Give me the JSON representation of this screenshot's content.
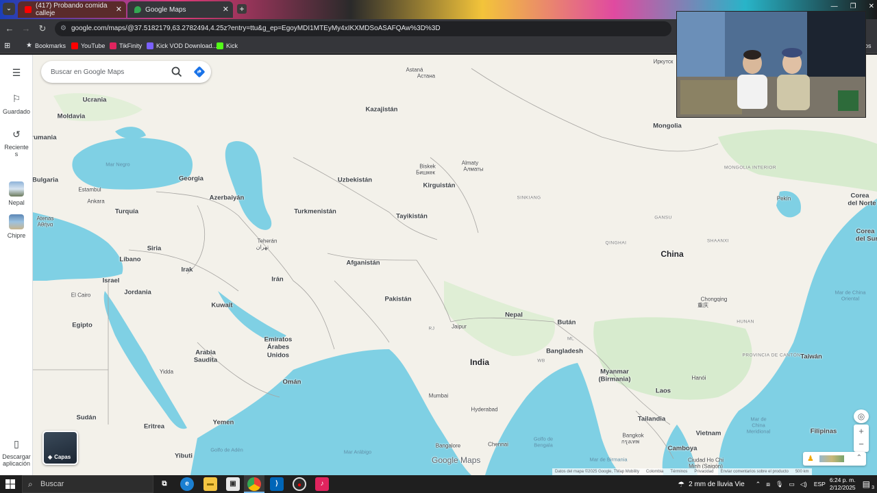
{
  "browser": {
    "tabs": [
      {
        "title": "(417) Probando comida calleje",
        "active": false
      },
      {
        "title": "Google Maps",
        "active": true
      }
    ],
    "url": "google.com/maps/@37.5182179,63.2782494,4.25z?entry=ttu&g_ep=EgoyMDI1MTEyMy4xIKXMDSoASAFQAw%3D%3D",
    "bookmarks": [
      "Bookmarks",
      "YouTube",
      "TikFinity",
      "Kick VOD Download...",
      "Kick"
    ],
    "bookmark_overflow": "os"
  },
  "maps": {
    "search_placeholder": "Buscar en Google Maps",
    "rail": {
      "saved": "Guardado",
      "recent_1": "Reciente",
      "recent_2": "s",
      "recent_places": [
        "Nepal",
        "Chipre"
      ],
      "download_1": "Descargar",
      "download_2": "aplicación"
    },
    "layers_label": "Capas",
    "logo": "Google Maps",
    "attribution": [
      "Datos del mapa ©2025 Google, TMap Mobility",
      "Colombia",
      "Términos",
      "Privacidad",
      "Enviar comentarios sobre el producto",
      "500 km"
    ],
    "labels": {
      "astana": "Astaná",
      "astana2": "Астана",
      "kazajistan": "Kazajistán",
      "ucrania": "Ucrania",
      "moldavia": "Moldavia",
      "rumania": "rumania",
      "mar_negro": "Mar Negro",
      "bulgaria": "Bulgaria",
      "estambul": "Estambul",
      "ankara": "Ankara",
      "turquia": "Turquía",
      "atenas": "Atenas",
      "atenas2": "Αθήνα",
      "georgia": "Georgia",
      "azerbaiyan": "Azerbaiyán",
      "uzbekistan": "Uzbekistán",
      "turkmenistan": "Turkmenistán",
      "tayikistan": "Tayikistán",
      "kirguistan": "Kirguistán",
      "bishkek": "Biskek",
      "bishkek2": "Бишкек",
      "almaty": "Almaty",
      "almaty2": "Алматы",
      "mongolia": "Mongolia",
      "mongolia_interior": "MONGOLIA INTERIOR",
      "irkutsk": "Иркутск",
      "pekin": "Pekín",
      "corea_norte_1": "Corea",
      "corea_norte_2": "del Norte",
      "corea_sur_1": "Corea",
      "corea_sur_2": "del Sur",
      "xinjiang": "SINKIANG",
      "gansu": "GANSU",
      "qinghai": "QINGHAI",
      "china": "China",
      "shaanxi": "SHAANXI",
      "chongqing": "Chongqing",
      "chongqing2": "重庆",
      "hunan": "HUNAN",
      "guangdong": "PROVINCIA DE CANTÓN",
      "mar_china_oriental_1": "Mar de China",
      "mar_china_oriental_2": "Oriental",
      "taiwan": "Taiwán",
      "siria": "Siria",
      "libano": "Líbano",
      "israel": "Israel",
      "el_cairo": "El Cairo",
      "jordania": "Jordania",
      "irak": "Irak",
      "teheran": "Teherán",
      "teheran2": "تهران",
      "iran": "Irán",
      "afganistan": "Afganistán",
      "pakistan": "Pakistán",
      "kuwait": "Kuwait",
      "egipto": "Egipto",
      "emiratos_1": "Emiratos",
      "emiratos_2": "Árabes",
      "emiratos_3": "Unidos",
      "arabia_1": "Arabia",
      "arabia_2": "Saudita",
      "yidda": "Yidda",
      "oman": "Omán",
      "yemen": "Yemen",
      "sudan": "Sudán",
      "eritrea": "Eritrea",
      "yibuti": "Yibuti",
      "golfo_aden": "Golfo de Adén",
      "mar_arabigo": "Mar Arábigo",
      "jaipur": "Jaipur",
      "nepal": "Nepal",
      "butan": "Bután",
      "india": "India",
      "bangladesh": "Bangladesh",
      "mumbai": "Mumbai",
      "hyderabad": "Hyderabad",
      "bangalore": "Bangalore",
      "chennai": "Chennai",
      "golfo_bengala_1": "Golfo de",
      "golfo_bengala_2": "Bengala",
      "myanmar_1": "Myanmar",
      "myanmar_2": "(Birmania)",
      "laos": "Laos",
      "hanoi": "Hanói",
      "tailandia": "Tailandia",
      "bangkok": "Bangkok",
      "bangkok2": "กรุงเทพ",
      "vietnam": "Vietnam",
      "camboya": "Camboya",
      "hcmc_1": "Ciudad Ho Chi",
      "hcmc_2": "Minh (Saigón)",
      "mar_birmania": "Mar de Birmania",
      "mar_china_meridional_1": "Mar de",
      "mar_china_meridional_2": "China",
      "mar_china_meridional_3": "Meridional",
      "filipinas": "Filipinas",
      "rj": "RJ",
      "wb": "WB",
      "ml": "ML"
    }
  },
  "taskbar": {
    "search_placeholder": "Buscar",
    "weather": "2 mm de lluvia Vie",
    "language": "ESP",
    "time": "6:24 p. m.",
    "date": "2/12/2025",
    "notification_count": "3"
  },
  "colors": {
    "water": "#7fd0e4",
    "land": "#f3f1ea",
    "green_land": "#d7ebce",
    "border": "#9a9a9a",
    "accent": "#1a73e8"
  }
}
